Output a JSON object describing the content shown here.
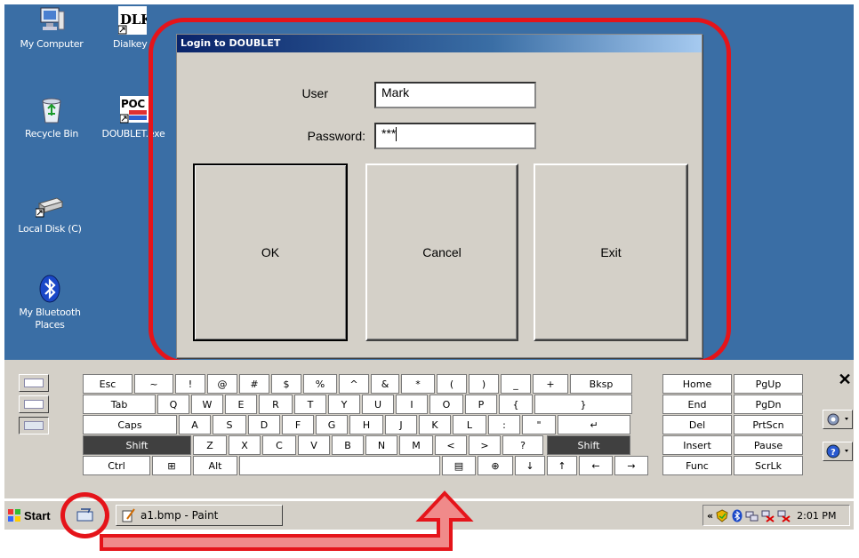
{
  "desktop": {
    "icons": [
      {
        "label": "My Computer"
      },
      {
        "label": "Dialkey"
      },
      {
        "label": "Recycle Bin"
      },
      {
        "label": "DOUBLET.exe"
      },
      {
        "label": "Local Disk (C)"
      },
      {
        "label": "My Bluetooth Places"
      }
    ],
    "icon_glyphs": {
      "dialkey": "DLK",
      "doublet": "POC"
    }
  },
  "dialog": {
    "title": "Login to DOUBLET",
    "user_label": "User",
    "user_value": "Mark",
    "password_label": "Password:",
    "password_value": "***",
    "ok_label": "OK",
    "cancel_label": "Cancel",
    "exit_label": "Exit"
  },
  "keyboard": {
    "row1": [
      "Esc",
      "~",
      "!",
      "@",
      "#",
      "$",
      "%",
      "^",
      "&",
      "*",
      "(",
      ")",
      "_",
      "+",
      "Bksp"
    ],
    "row2": [
      "Tab",
      "Q",
      "W",
      "E",
      "R",
      "T",
      "Y",
      "U",
      "I",
      "O",
      "P",
      "{",
      "}",
      "|"
    ],
    "row3": [
      "Caps",
      "A",
      "S",
      "D",
      "F",
      "G",
      "H",
      "J",
      "K",
      "L",
      ":",
      "\"",
      "↵"
    ],
    "row4": [
      "Shift",
      "Z",
      "X",
      "C",
      "V",
      "B",
      "N",
      "M",
      "<",
      ">",
      "?",
      "Shift"
    ],
    "row5": [
      "Ctrl",
      "⊞",
      "Alt",
      "",
      "▤",
      "⊕",
      "↓",
      "↑",
      "←",
      "→"
    ],
    "nav": [
      "Home",
      "PgUp",
      "End",
      "PgDn",
      "Del",
      "PrtScn",
      "Insert",
      "Pause",
      "Func",
      "ScrLk"
    ],
    "close_glyph": "✕"
  },
  "taskbar": {
    "start_label": "Start",
    "paint_task_label": "a1.bmp - Paint",
    "tray_chevron": "«",
    "clock": "2:01 PM"
  },
  "colors": {
    "desktop": "#3a6ea5",
    "annotation_red": "#e5141a",
    "panel": "#d4d0c8"
  }
}
